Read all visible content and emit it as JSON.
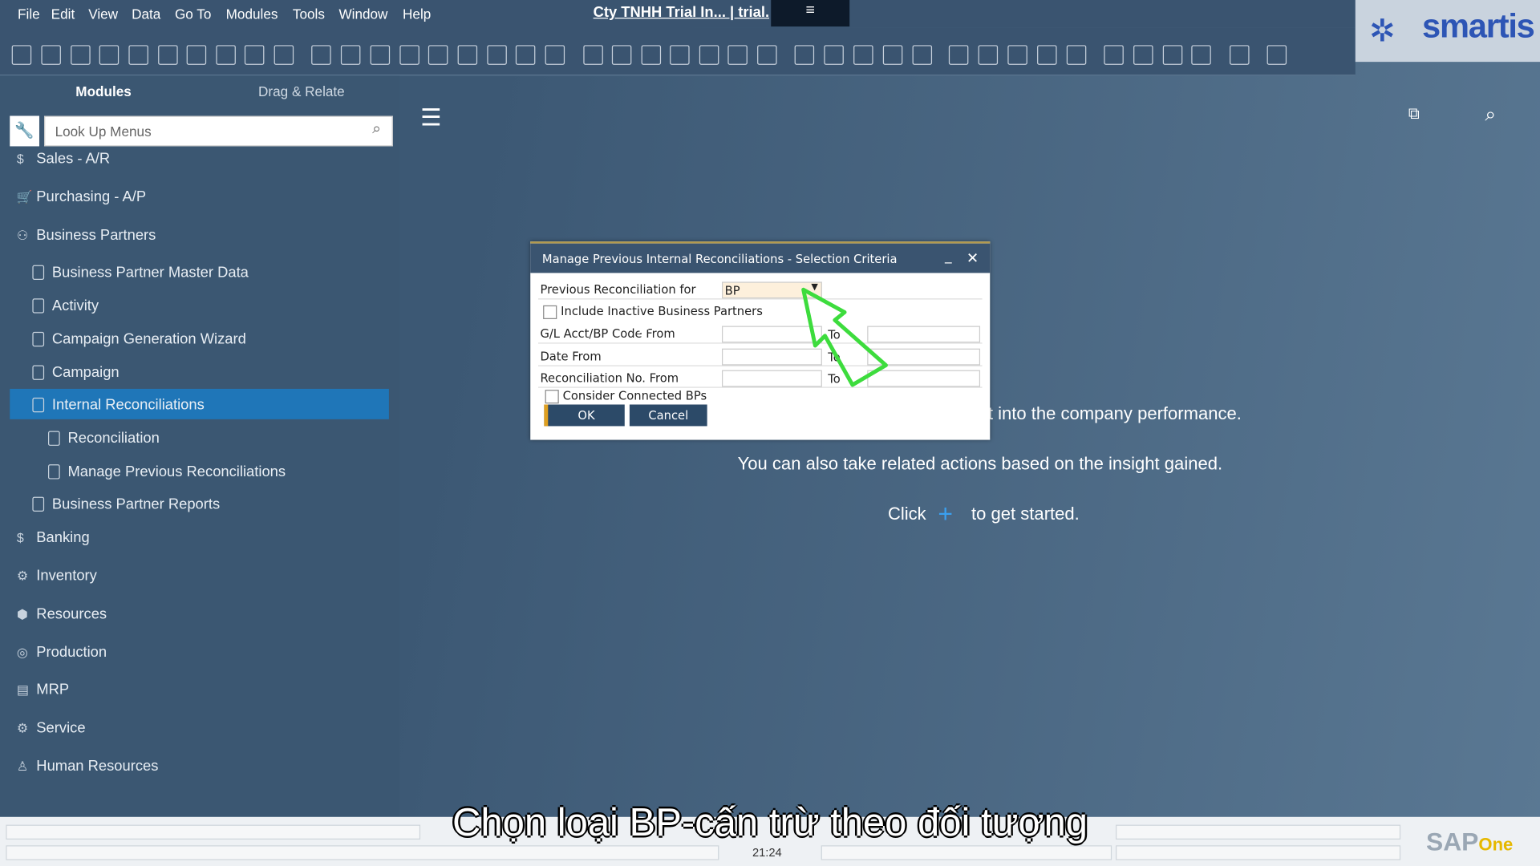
{
  "menubar": {
    "items": [
      "File",
      "Edit",
      "View",
      "Data",
      "Go To",
      "Modules",
      "Tools",
      "Window",
      "Help"
    ],
    "title": "Cty TNHH Trial In... | trial."
  },
  "logo": {
    "text": "smartis"
  },
  "sidebar": {
    "tabs": [
      "Modules",
      "Drag & Relate"
    ],
    "search_placeholder": "Look Up Menus",
    "items": [
      {
        "label": "Sales - A/R",
        "level": 0,
        "icon": "dollar-icon"
      },
      {
        "label": "Purchasing - A/P",
        "level": 0,
        "icon": "cart-icon"
      },
      {
        "label": "Business Partners",
        "level": 0,
        "icon": "partners-icon"
      },
      {
        "label": "Business Partner Master Data",
        "level": 1,
        "icon": "document-icon"
      },
      {
        "label": "Activity",
        "level": 1,
        "icon": "document-icon"
      },
      {
        "label": "Campaign Generation Wizard",
        "level": 1,
        "icon": "document-icon"
      },
      {
        "label": "Campaign",
        "level": 1,
        "icon": "document-icon"
      },
      {
        "label": "Internal Reconciliations",
        "level": 1,
        "icon": "folder-icon",
        "selected": true
      },
      {
        "label": "Reconciliation",
        "level": 2,
        "icon": "document-icon"
      },
      {
        "label": "Manage Previous Reconciliations",
        "level": 2,
        "icon": "document-icon"
      },
      {
        "label": "Business Partner Reports",
        "level": 1,
        "icon": "folder-icon"
      },
      {
        "label": "Banking",
        "level": 0,
        "icon": "bank-icon"
      },
      {
        "label": "Inventory",
        "level": 0,
        "icon": "inventory-icon"
      },
      {
        "label": "Resources",
        "level": 0,
        "icon": "resources-icon"
      },
      {
        "label": "Production",
        "level": 0,
        "icon": "production-icon"
      },
      {
        "label": "MRP",
        "level": 0,
        "icon": "mrp-icon"
      },
      {
        "label": "Service",
        "level": 0,
        "icon": "service-icon"
      },
      {
        "label": "Human Resources",
        "level": 0,
        "icon": "person-icon"
      }
    ]
  },
  "dialog": {
    "title": "Manage Previous Internal Reconciliations - Selection Criteria",
    "prev_recon_label": "Previous Reconciliation for",
    "prev_recon_value": "BP",
    "include_inactive": "Include Inactive Business Partners",
    "gl_label": "G/L Acct/BP Code From",
    "date_label": "Date From",
    "recon_no_label": "Reconciliation No. From",
    "to_label": "To",
    "consider_connected": "Consider Connected BPs",
    "ok": "OK",
    "cancel": "Cancel"
  },
  "main": {
    "line1": "t into the company performance.",
    "line2": "You can also take related actions based on the insight gained.",
    "click": "Click",
    "get_started": "to get started."
  },
  "status": {
    "time": "21:24"
  },
  "subtitle": "Chọn loại BP-cấn trừ theo đối tượng",
  "colors": {
    "accent": "#1f76b8",
    "background": "#3e5a76",
    "annotation_arrow": "#3ddc3d"
  }
}
